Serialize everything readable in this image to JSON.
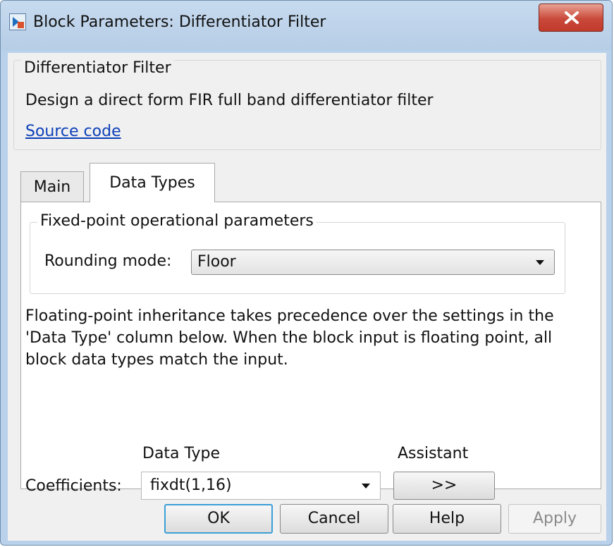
{
  "window": {
    "title": "Block Parameters: Differentiator Filter"
  },
  "description": {
    "group_title": "Differentiator Filter",
    "text": "Design a direct form FIR full band differentiator filter",
    "link": "Source code"
  },
  "tabs": [
    {
      "label": "Main",
      "active": false
    },
    {
      "label": "Data Types",
      "active": true
    }
  ],
  "fixed_point": {
    "group_title": "Fixed-point operational parameters",
    "rounding_label": "Rounding mode:",
    "rounding_value": "Floor"
  },
  "info_text": "Floating-point inheritance takes precedence over the settings in the 'Data Type' column below. When the block input is floating point, all block data types match the input.",
  "table": {
    "col_data_type": "Data Type",
    "col_assistant": "Assistant",
    "rows": [
      {
        "label": "Coefficients:",
        "value": "fixdt(1,16)",
        "assistant_label": ">>"
      }
    ]
  },
  "buttons": {
    "ok": "OK",
    "cancel": "Cancel",
    "help": "Help",
    "apply": "Apply"
  },
  "icons": {
    "app": "simulink-block-icon",
    "close": "close-icon"
  }
}
